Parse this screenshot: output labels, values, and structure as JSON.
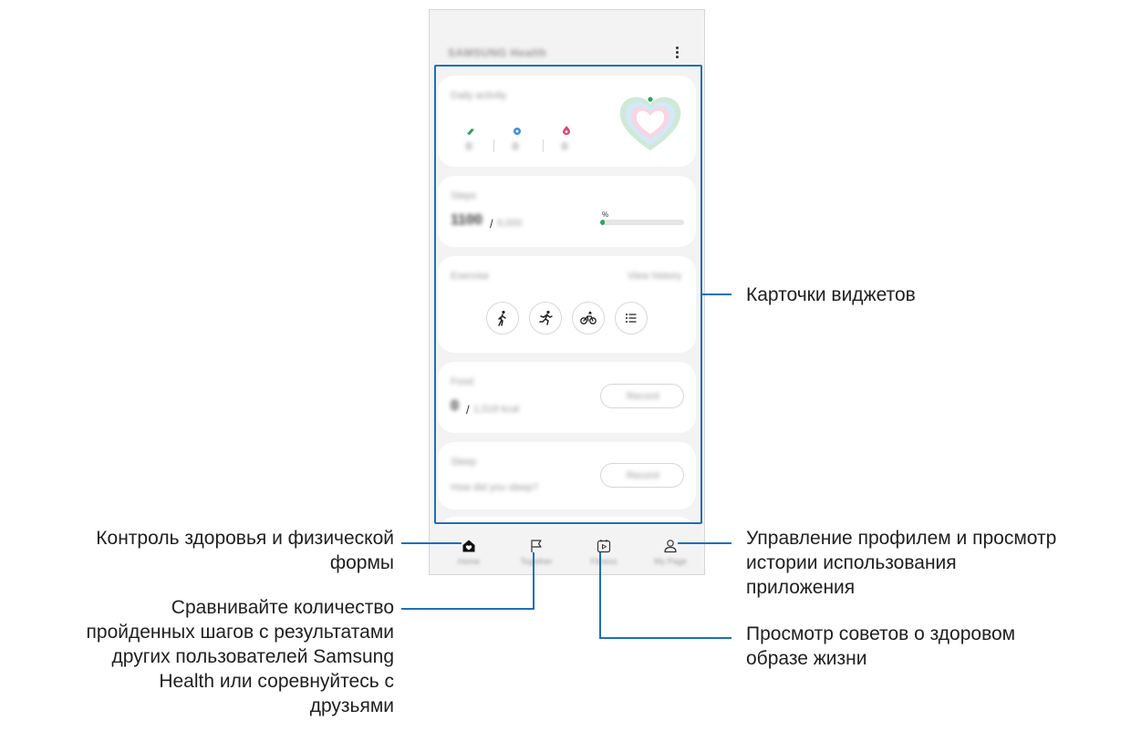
{
  "app": {
    "title": "SAMSUNG Health",
    "more_icon": "more-vert-icon"
  },
  "cards": {
    "daily_activity": {
      "title": "Daily activity",
      "stats": [
        {
          "icon": "steps-icon",
          "color": "#2ea25c",
          "value": "0"
        },
        {
          "icon": "active-time-icon",
          "color": "#3b8fd9",
          "value": "0"
        },
        {
          "icon": "calories-icon",
          "color": "#e2417d",
          "value": "0"
        }
      ],
      "rings_icon": "activity-rings-icon"
    },
    "steps": {
      "title": "Steps",
      "value": "1100",
      "separator": "/",
      "goal": "6,000",
      "percent_suffix": "%",
      "progress": 0.05
    },
    "exercise": {
      "title": "Exercise",
      "link": "View history",
      "buttons": [
        "walking-icon",
        "running-icon",
        "cycling-icon",
        "list-icon"
      ]
    },
    "food": {
      "title": "Food",
      "value": "0",
      "separator": "/",
      "goal": "1,518 kcal",
      "button": "Record"
    },
    "sleep": {
      "title": "Sleep",
      "subtitle": "How did you sleep?",
      "button": "Record"
    }
  },
  "navbar": {
    "items": [
      {
        "icon": "home-icon",
        "label": "Home"
      },
      {
        "icon": "flag-icon",
        "label": "Together"
      },
      {
        "icon": "video-icon",
        "label": "Fitness"
      },
      {
        "icon": "person-icon",
        "label": "My Page"
      }
    ]
  },
  "callouts": {
    "widgets": "Карточки виджетов",
    "home_line1": "Контроль здоровья и физической",
    "home_line2": "формы",
    "together_lines": [
      "Сравнивайте количество",
      "пройденных шагов с результатами",
      "других пользователей Samsung",
      "Health или соревнуйтесь с",
      "друзьями"
    ],
    "profile_lines": [
      "Управление профилем и просмотр",
      "истории использования",
      "приложения"
    ],
    "fitness_lines": [
      "Просмотр советов о здоровом",
      "образе жизни"
    ]
  },
  "colors": {
    "accent": "#1d6fb8",
    "steps_green": "#2ea25c"
  }
}
